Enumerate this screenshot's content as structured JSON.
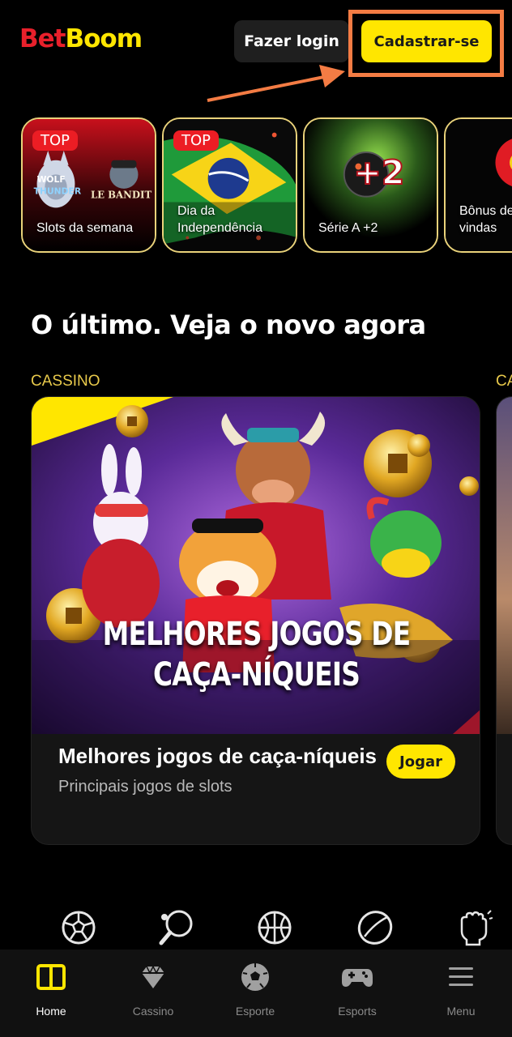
{
  "header": {
    "logo_part1": "Bet",
    "logo_part2": "Boom",
    "login_label": "Fazer login",
    "signup_label": "Cadastrar-se"
  },
  "stories": [
    {
      "badge": "TOP",
      "label": "Slots da semana"
    },
    {
      "badge": "TOP",
      "label": "Dia da Independência"
    },
    {
      "badge": "",
      "label": "Série A +2"
    },
    {
      "badge": "",
      "label": "Bônus de boas-vindas"
    }
  ],
  "section": {
    "title": "O último. Veja o novo agora",
    "category": "CASSINO",
    "category_peek": "CA"
  },
  "card": {
    "banner_line1": "MELHORES JOGOS DE",
    "banner_line2": "CAÇA-NÍQUEIS",
    "title": "Melhores jogos de caça-níqueis",
    "subtitle": "Principais jogos de slots",
    "play_label": "Jogar"
  },
  "sports_icons": [
    "soccer-ball-icon",
    "table-tennis-icon",
    "basketball-icon",
    "hockey-puck-icon",
    "fighting-fist-icon"
  ],
  "bottom_nav": [
    {
      "label": "Home",
      "icon": "home-panel-icon",
      "active": true
    },
    {
      "label": "Cassino",
      "icon": "diamond-icon",
      "active": false
    },
    {
      "label": "Esporte",
      "icon": "soccer-icon",
      "active": false
    },
    {
      "label": "Esports",
      "icon": "gamepad-icon",
      "active": false
    },
    {
      "label": "Menu",
      "icon": "hamburger-icon",
      "active": false
    }
  ],
  "colors": {
    "brand_yellow": "#ffe600",
    "brand_red": "#e8202b",
    "highlight_orange": "#f47c44",
    "story_border": "#e9d27a",
    "category_gold": "#e8c94b"
  }
}
